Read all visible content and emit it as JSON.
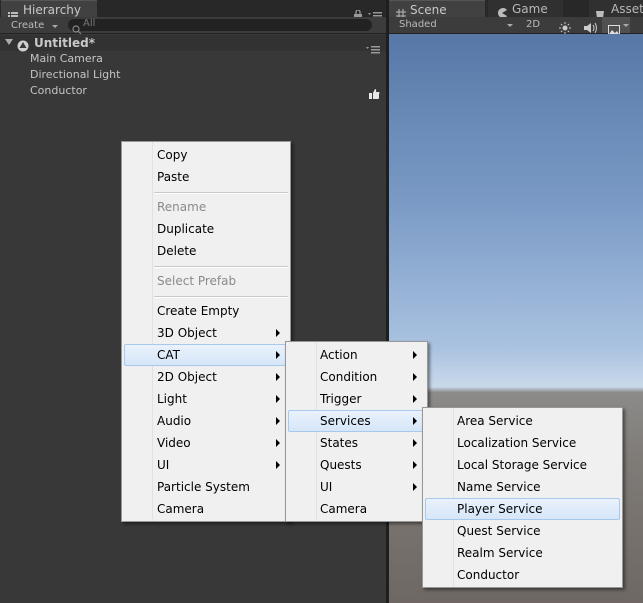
{
  "hierarchy": {
    "tab_label": "Hierarchy",
    "create_label": "Create",
    "search_placeholder": "All",
    "scene_name": "Untitled*",
    "items": [
      "Main Camera",
      "Directional Light",
      "Conductor"
    ]
  },
  "scene_panel": {
    "tabs": [
      "Scene",
      "Game",
      "Asset"
    ],
    "shading_mode": "Shaded",
    "mode_2d": "2D"
  },
  "context_menu": {
    "items": [
      {
        "label": "Copy",
        "disabled": false,
        "submenu": false
      },
      {
        "label": "Paste",
        "disabled": false,
        "submenu": false
      },
      {
        "label": "Rename",
        "disabled": true,
        "submenu": false
      },
      {
        "label": "Duplicate",
        "disabled": false,
        "submenu": false
      },
      {
        "label": "Delete",
        "disabled": false,
        "submenu": false
      },
      {
        "label": "Select Prefab",
        "disabled": true,
        "submenu": false
      },
      {
        "label": "Create Empty",
        "disabled": false,
        "submenu": false
      },
      {
        "label": "3D Object",
        "disabled": false,
        "submenu": true
      },
      {
        "label": "CAT",
        "disabled": false,
        "submenu": true,
        "highlighted": true
      },
      {
        "label": "2D Object",
        "disabled": false,
        "submenu": true
      },
      {
        "label": "Light",
        "disabled": false,
        "submenu": true
      },
      {
        "label": "Audio",
        "disabled": false,
        "submenu": true
      },
      {
        "label": "Video",
        "disabled": false,
        "submenu": true
      },
      {
        "label": "UI",
        "disabled": false,
        "submenu": true
      },
      {
        "label": "Particle System",
        "disabled": false,
        "submenu": false
      },
      {
        "label": "Camera",
        "disabled": false,
        "submenu": false
      }
    ]
  },
  "cat_submenu": {
    "items": [
      {
        "label": "Action",
        "submenu": true
      },
      {
        "label": "Condition",
        "submenu": true
      },
      {
        "label": "Trigger",
        "submenu": true
      },
      {
        "label": "Services",
        "submenu": true,
        "highlighted": true
      },
      {
        "label": "States",
        "submenu": true
      },
      {
        "label": "Quests",
        "submenu": true
      },
      {
        "label": "UI",
        "submenu": true
      },
      {
        "label": "Camera",
        "submenu": false
      }
    ]
  },
  "services_submenu": {
    "items": [
      {
        "label": "Area Service"
      },
      {
        "label": "Localization Service"
      },
      {
        "label": "Local Storage Service"
      },
      {
        "label": "Name Service"
      },
      {
        "label": "Player Service",
        "highlighted": true
      },
      {
        "label": "Quest Service"
      },
      {
        "label": "Realm Service"
      },
      {
        "label": "Conductor"
      }
    ]
  }
}
